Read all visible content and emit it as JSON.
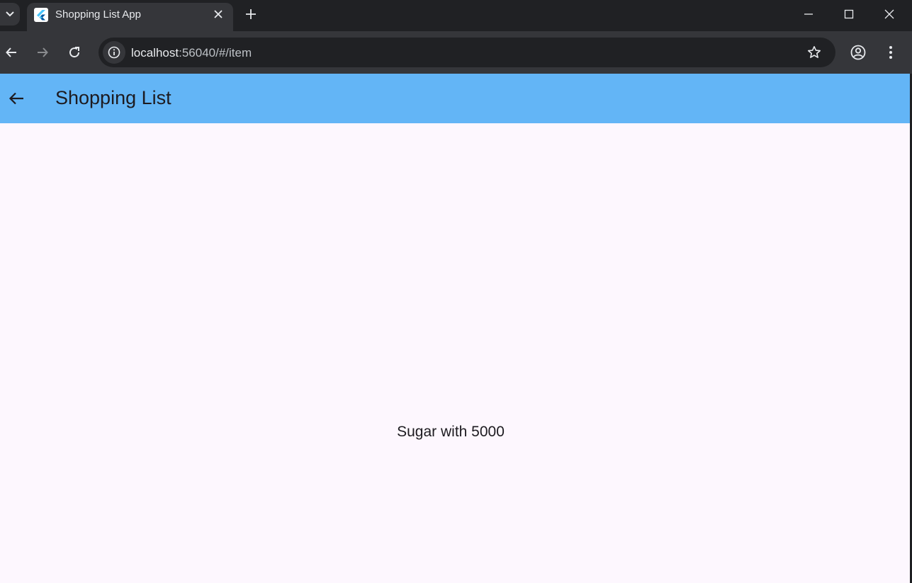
{
  "browser": {
    "tab": {
      "title": "Shopping List App",
      "favicon": "flutter-icon"
    },
    "address_bar": {
      "host": "localhost",
      "path": ":56040/#/item"
    }
  },
  "app": {
    "title": "Shopping List",
    "appbar_color": "#63b5f6",
    "background_color": "#fdf7fe",
    "item_text": "Sugar with 5000"
  }
}
